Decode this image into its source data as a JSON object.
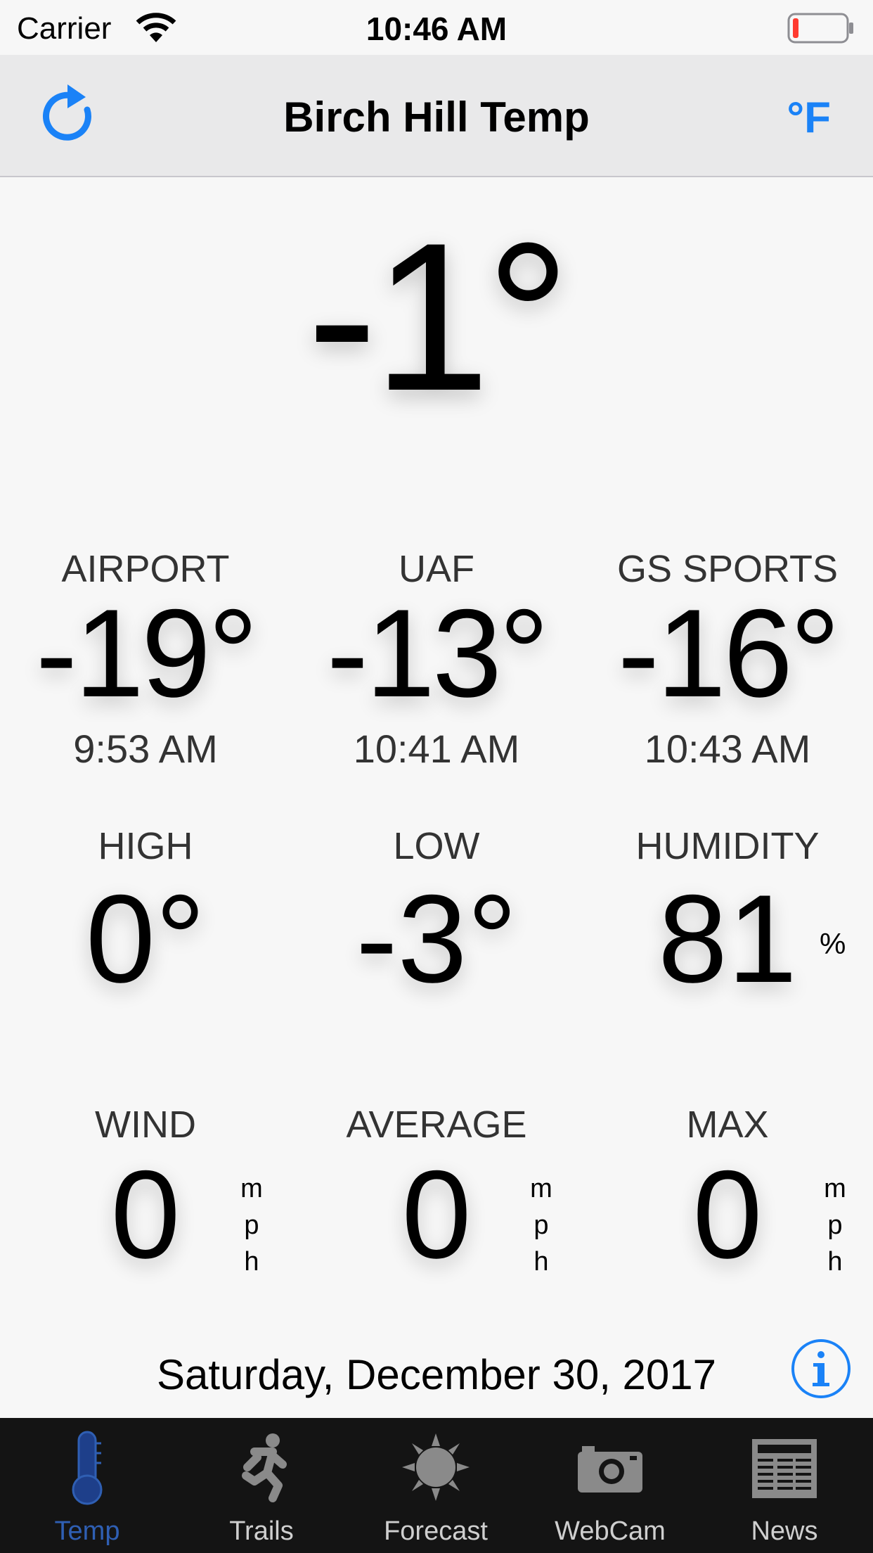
{
  "status_bar": {
    "carrier": "Carrier",
    "time": "10:46 AM"
  },
  "nav": {
    "title": "Birch Hill Temp",
    "unit_label": "°F"
  },
  "current": {
    "temp": "-1°"
  },
  "stations": [
    {
      "name": "AIRPORT",
      "temp": "-19°",
      "time": "9:53 AM"
    },
    {
      "name": "UAF",
      "temp": "-13°",
      "time": "10:41 AM"
    },
    {
      "name": "GS SPORTS",
      "temp": "-16°",
      "time": "10:43 AM"
    }
  ],
  "stats": {
    "high": {
      "label": "HIGH",
      "value": "0°"
    },
    "low": {
      "label": "LOW",
      "value": "-3°"
    },
    "humidity": {
      "label": "HUMIDITY",
      "value": "81",
      "unit": "%"
    }
  },
  "wind": [
    {
      "label": "WIND",
      "value": "0",
      "unit": [
        "m",
        "p",
        "h"
      ]
    },
    {
      "label": "AVERAGE",
      "value": "0",
      "unit": [
        "m",
        "p",
        "h"
      ]
    },
    {
      "label": "MAX",
      "value": "0",
      "unit": [
        "m",
        "p",
        "h"
      ]
    }
  ],
  "date": "Saturday, December 30, 2017",
  "tabs": [
    {
      "label": "Temp",
      "icon": "thermometer-icon",
      "active": true
    },
    {
      "label": "Trails",
      "icon": "runner-icon",
      "active": false
    },
    {
      "label": "Forecast",
      "icon": "sun-icon",
      "active": false
    },
    {
      "label": "WebCam",
      "icon": "camera-icon",
      "active": false
    },
    {
      "label": "News",
      "icon": "newspaper-icon",
      "active": false
    }
  ],
  "colors": {
    "accent": "#1a82f7",
    "tab_active": "#2f5fb3",
    "battery_low": "#ff3b30"
  }
}
